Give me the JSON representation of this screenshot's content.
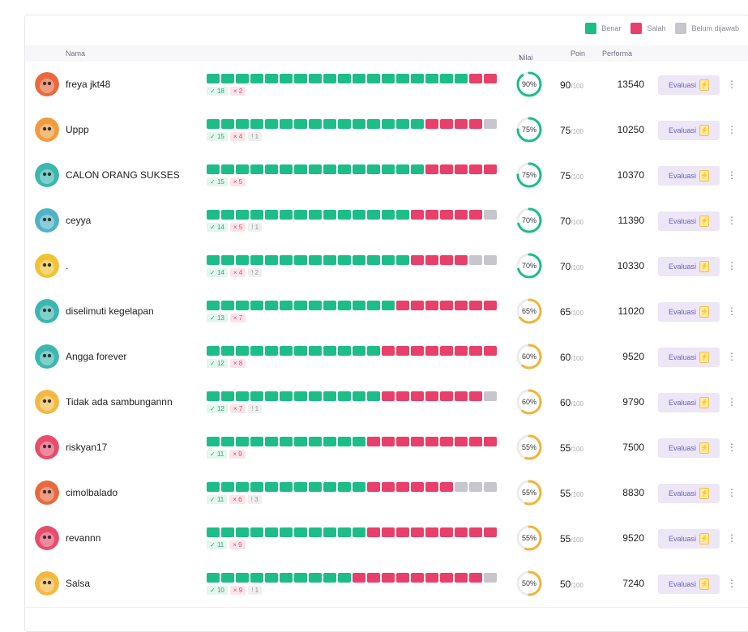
{
  "legend": {
    "benar": {
      "label": "Benar",
      "color": "#1dbd87"
    },
    "salah": {
      "label": "Salah",
      "color": "#e8406a"
    },
    "belum": {
      "label": "Belum dijawab",
      "color": "#c6c6cc"
    }
  },
  "header": {
    "nama": "Nama",
    "nilai": "Nilai",
    "sort_icon": "arrow-up-icon",
    "poin": "Poin",
    "performa": "Performa"
  },
  "total_questions": 20,
  "rows": [
    {
      "name": "freya jkt48",
      "correct": 18,
      "wrong": 2,
      "unanswered": 0,
      "correct_label": "18",
      "wrong_label": "2",
      "unanswered_label": "",
      "pct_label": "90%",
      "pct": 90,
      "poin": "90",
      "poin_max": "/100",
      "performa": "13540",
      "eval_label": "Evaluasi",
      "avatar_color": "#e9683d"
    },
    {
      "name": "Uppp",
      "correct": 15,
      "wrong": 4,
      "unanswered": 1,
      "correct_label": "15",
      "wrong_label": "4",
      "unanswered_label": "1",
      "pct_label": "75%",
      "pct": 75,
      "poin": "75",
      "poin_max": "/100",
      "performa": "10250",
      "eval_label": "Evaluasi",
      "avatar_color": "#f29b3a"
    },
    {
      "name": "CALON ORANG SUKSES",
      "correct": 15,
      "wrong": 5,
      "unanswered": 0,
      "correct_label": "15",
      "wrong_label": "5",
      "unanswered_label": "",
      "pct_label": "75%",
      "pct": 75,
      "poin": "75",
      "poin_max": "/100",
      "performa": "10370",
      "eval_label": "Evaluasi",
      "avatar_color": "#3bb7b0"
    },
    {
      "name": "ceyya",
      "correct": 14,
      "wrong": 5,
      "unanswered": 1,
      "correct_label": "14",
      "wrong_label": "5",
      "unanswered_label": "1",
      "pct_label": "70%",
      "pct": 70,
      "poin": "70",
      "poin_max": "/100",
      "performa": "11390",
      "eval_label": "Evaluasi",
      "avatar_color": "#4fb3c6"
    },
    {
      "name": ".",
      "correct": 14,
      "wrong": 4,
      "unanswered": 2,
      "correct_label": "14",
      "wrong_label": "4",
      "unanswered_label": "2",
      "pct_label": "70%",
      "pct": 70,
      "poin": "70",
      "poin_max": "/100",
      "performa": "10330",
      "eval_label": "Evaluasi",
      "avatar_color": "#f1c232"
    },
    {
      "name": "diselimuti kegelapan",
      "correct": 13,
      "wrong": 7,
      "unanswered": 0,
      "correct_label": "13",
      "wrong_label": "7",
      "unanswered_label": "",
      "pct_label": "65%",
      "pct": 65,
      "poin": "65",
      "poin_max": "/100",
      "performa": "11020",
      "eval_label": "Evaluasi",
      "avatar_color": "#3bb7b0"
    },
    {
      "name": "Angga forever",
      "correct": 12,
      "wrong": 8,
      "unanswered": 0,
      "correct_label": "12",
      "wrong_label": "8",
      "unanswered_label": "",
      "pct_label": "60%",
      "pct": 60,
      "poin": "60",
      "poin_max": "/100",
      "performa": "9520",
      "eval_label": "Evaluasi",
      "avatar_color": "#3bb7b0"
    },
    {
      "name": "Tidak ada sambungannn",
      "correct": 12,
      "wrong": 7,
      "unanswered": 1,
      "correct_label": "12",
      "wrong_label": "7",
      "unanswered_label": "1",
      "pct_label": "60%",
      "pct": 60,
      "poin": "60",
      "poin_max": "/100",
      "performa": "9790",
      "eval_label": "Evaluasi",
      "avatar_color": "#f3b842"
    },
    {
      "name": "riskyan17",
      "correct": 11,
      "wrong": 9,
      "unanswered": 0,
      "correct_label": "11",
      "wrong_label": "9",
      "unanswered_label": "",
      "pct_label": "55%",
      "pct": 55,
      "poin": "55",
      "poin_max": "/100",
      "performa": "7500",
      "eval_label": "Evaluasi",
      "avatar_color": "#e74c6b"
    },
    {
      "name": "cimolbalado",
      "correct": 11,
      "wrong": 6,
      "unanswered": 3,
      "correct_label": "11",
      "wrong_label": "6",
      "unanswered_label": "3",
      "pct_label": "55%",
      "pct": 55,
      "poin": "55",
      "poin_max": "/100",
      "performa": "8830",
      "eval_label": "Evaluasi",
      "avatar_color": "#e9683d"
    },
    {
      "name": "revannn",
      "correct": 11,
      "wrong": 9,
      "unanswered": 0,
      "correct_label": "11",
      "wrong_label": "9",
      "unanswered_label": "",
      "pct_label": "55%",
      "pct": 55,
      "poin": "55",
      "poin_max": "/100",
      "performa": "9520",
      "eval_label": "Evaluasi",
      "avatar_color": "#e74c6b"
    },
    {
      "name": "Salsa",
      "correct": 10,
      "wrong": 9,
      "unanswered": 1,
      "correct_label": "10",
      "wrong_label": "9",
      "unanswered_label": "1",
      "pct_label": "50%",
      "pct": 50,
      "poin": "50",
      "poin_max": "/100",
      "performa": "7240",
      "eval_label": "Evaluasi",
      "avatar_color": "#f3b842"
    }
  ]
}
